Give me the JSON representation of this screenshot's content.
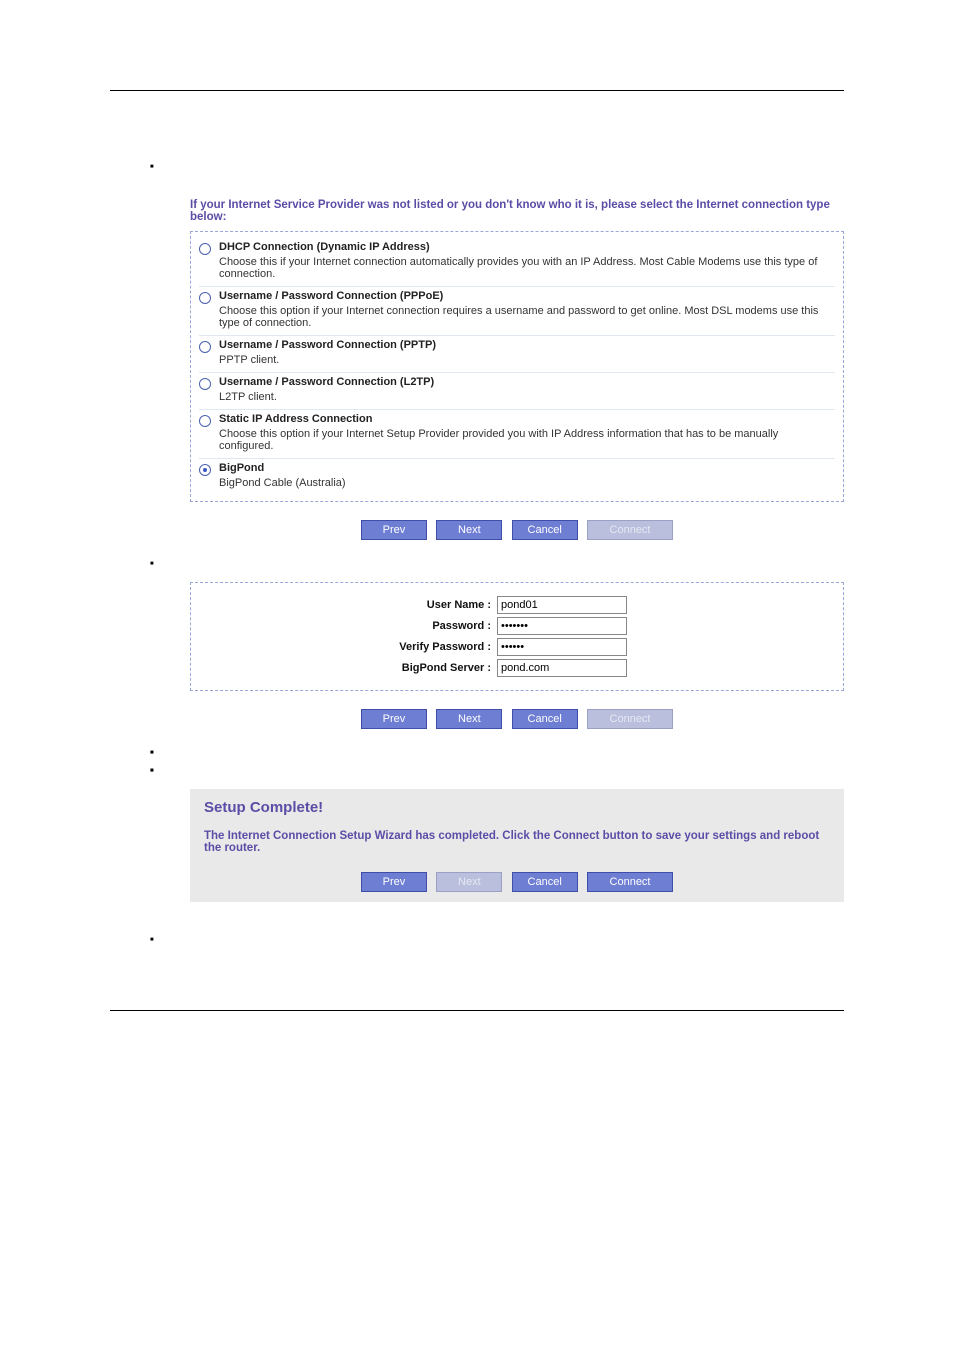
{
  "bullets_top": [
    ""
  ],
  "step1": {
    "instruction": "If your Internet Service Provider was not listed or you don't know who it is, please select the Internet connection type below:",
    "options": [
      {
        "title": "DHCP Connection (Dynamic IP Address)",
        "desc": "Choose this if your Internet connection automatically provides you with an IP Address. Most Cable Modems use this type of connection.",
        "selected": false
      },
      {
        "title": "Username / Password Connection (PPPoE)",
        "desc": "Choose this option if your Internet connection requires a username and password to get online. Most DSL modems use this type of connection.",
        "selected": false
      },
      {
        "title": "Username / Password Connection (PPTP)",
        "desc": "PPTP client.",
        "selected": false
      },
      {
        "title": "Username / Password Connection (L2TP)",
        "desc": "L2TP client.",
        "selected": false
      },
      {
        "title": "Static IP Address Connection",
        "desc": "Choose this option if your Internet Setup Provider provided you with IP Address information that has to be manually configured.",
        "selected": false
      },
      {
        "title": "BigPond",
        "desc": "BigPond Cable (Australia)",
        "selected": true
      }
    ],
    "buttons": {
      "prev": "Prev",
      "next": "Next",
      "cancel": "Cancel",
      "connect": "Connect"
    }
  },
  "bullets_mid1": [
    ""
  ],
  "step2_form": {
    "fields": [
      {
        "label": "User Name :",
        "value": "pond01",
        "type": "text"
      },
      {
        "label": "Password :",
        "value": "•••••••",
        "type": "password"
      },
      {
        "label": "Verify Password :",
        "value": "••••••",
        "type": "password"
      },
      {
        "label": "BigPond Server :",
        "value": "pond.com",
        "type": "text"
      }
    ],
    "buttons": {
      "prev": "Prev",
      "next": "Next",
      "cancel": "Cancel",
      "connect": "Connect"
    }
  },
  "bullets_mid2": [
    "",
    "",
    "",
    ""
  ],
  "complete": {
    "title": "Setup Complete!",
    "desc": "The Internet Connection Setup Wizard has completed. Click the Connect button to save your settings and reboot the router.",
    "buttons": {
      "prev": "Prev",
      "next": "Next",
      "cancel": "Cancel",
      "connect": "Connect"
    }
  },
  "bullets_bot": [
    ""
  ]
}
